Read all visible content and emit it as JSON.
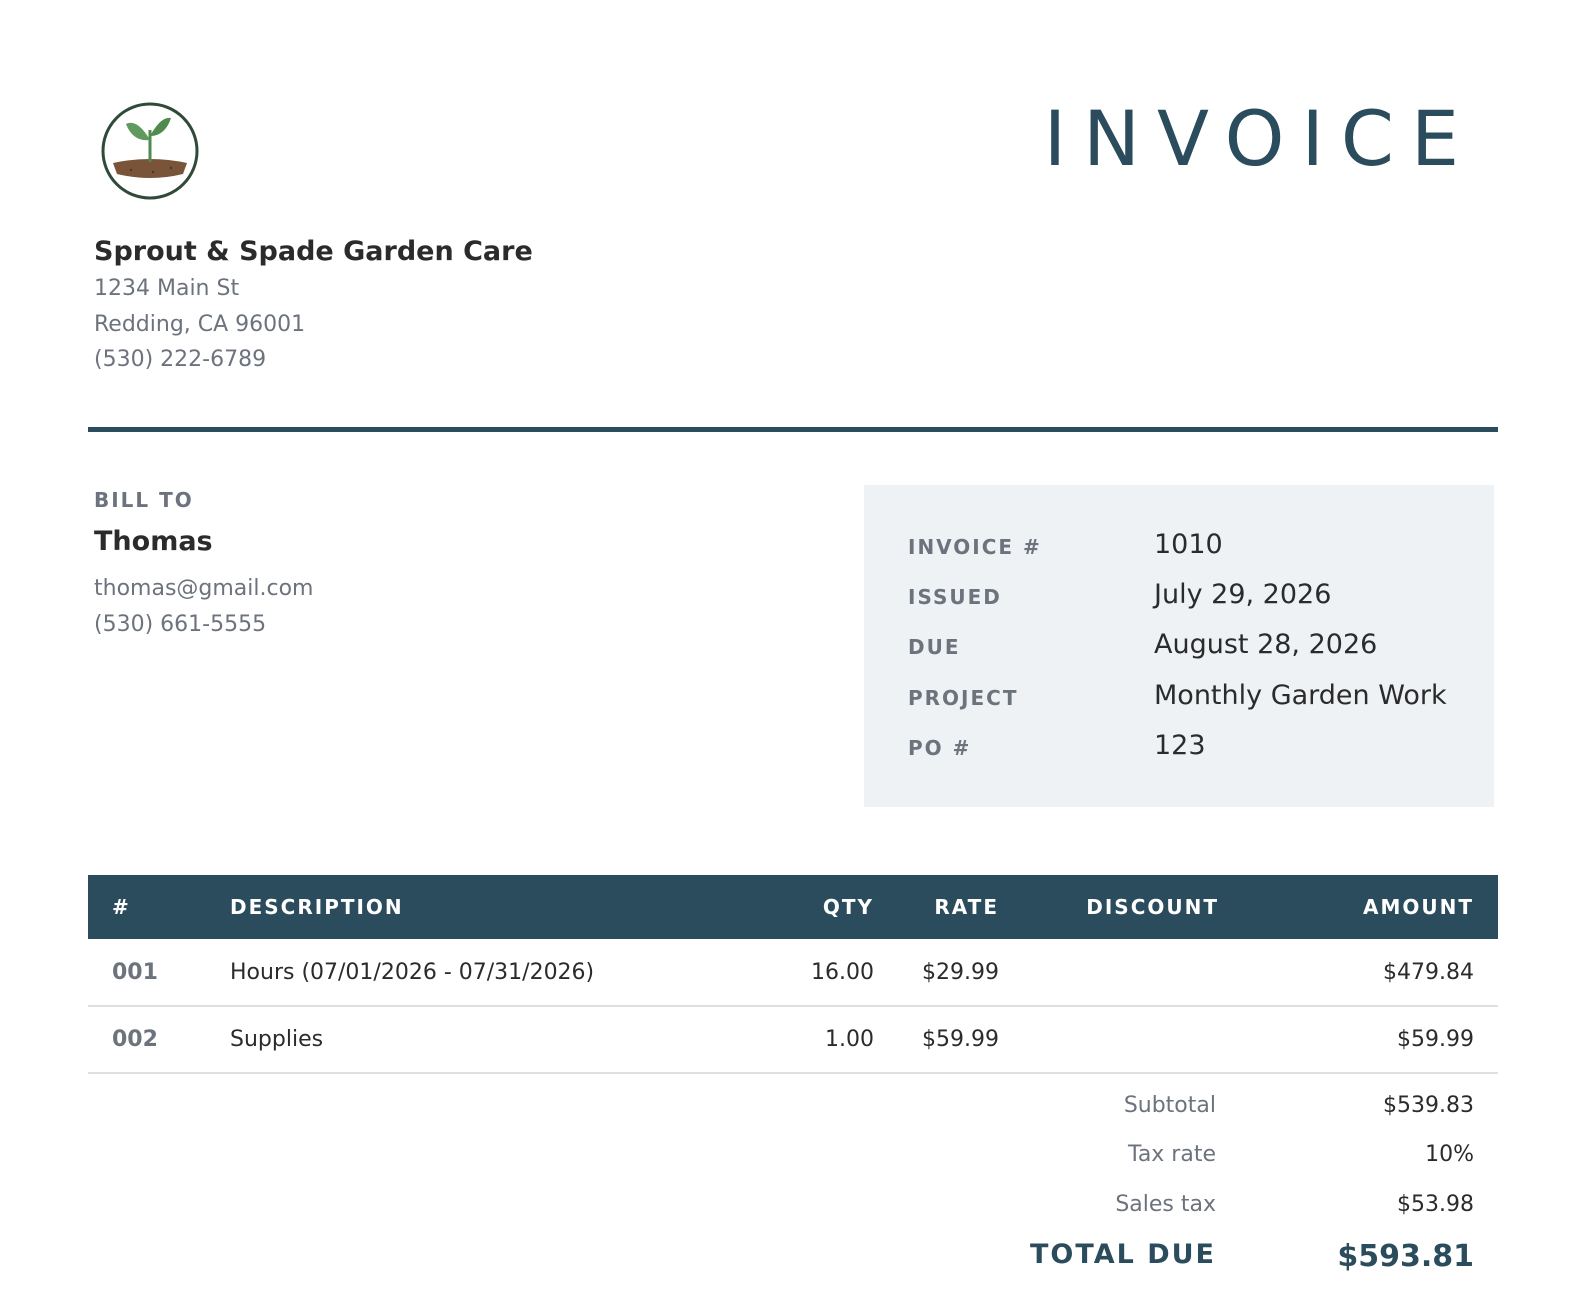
{
  "header": {
    "title": "INVOICE",
    "logo_icon": "seedling-icon"
  },
  "company": {
    "name": "Sprout & Spade Garden Care",
    "address_line1": "1234 Main St",
    "address_line2": "Redding, CA 96001",
    "phone": "(530) 222-6789"
  },
  "bill_to": {
    "label": "BILL TO",
    "name": "Thomas",
    "email": "thomas@gmail.com",
    "phone": "(530) 661-5555"
  },
  "meta": [
    {
      "key": "INVOICE #",
      "value": "1010"
    },
    {
      "key": "ISSUED",
      "value": "July 29, 2026"
    },
    {
      "key": "DUE",
      "value": "August 28, 2026"
    },
    {
      "key": "PROJECT",
      "value": "Monthly Garden Work"
    },
    {
      "key": "PO #",
      "value": "123"
    }
  ],
  "table": {
    "headers": {
      "num": "#",
      "description": "DESCRIPTION",
      "qty": "QTY",
      "rate": "RATE",
      "discount": "DISCOUNT",
      "amount": "AMOUNT"
    },
    "rows": [
      {
        "num": "001",
        "description": "Hours (07/01/2026 - 07/31/2026)",
        "qty": "16.00",
        "rate": "$29.99",
        "discount": "",
        "amount": "$479.84"
      },
      {
        "num": "002",
        "description": "Supplies",
        "qty": "1.00",
        "rate": "$59.99",
        "discount": "",
        "amount": "$59.99"
      }
    ]
  },
  "totals": {
    "subtotal_label": "Subtotal",
    "subtotal": "$539.83",
    "tax_rate_label": "Tax rate",
    "tax_rate": "10%",
    "sales_tax_label": "Sales tax",
    "sales_tax": "$53.98",
    "total_label": "TOTAL DUE",
    "total": "$593.81"
  },
  "colors": {
    "accent": "#2b4c5c",
    "muted_text": "#6d737d",
    "meta_background": "#eff2f5"
  }
}
